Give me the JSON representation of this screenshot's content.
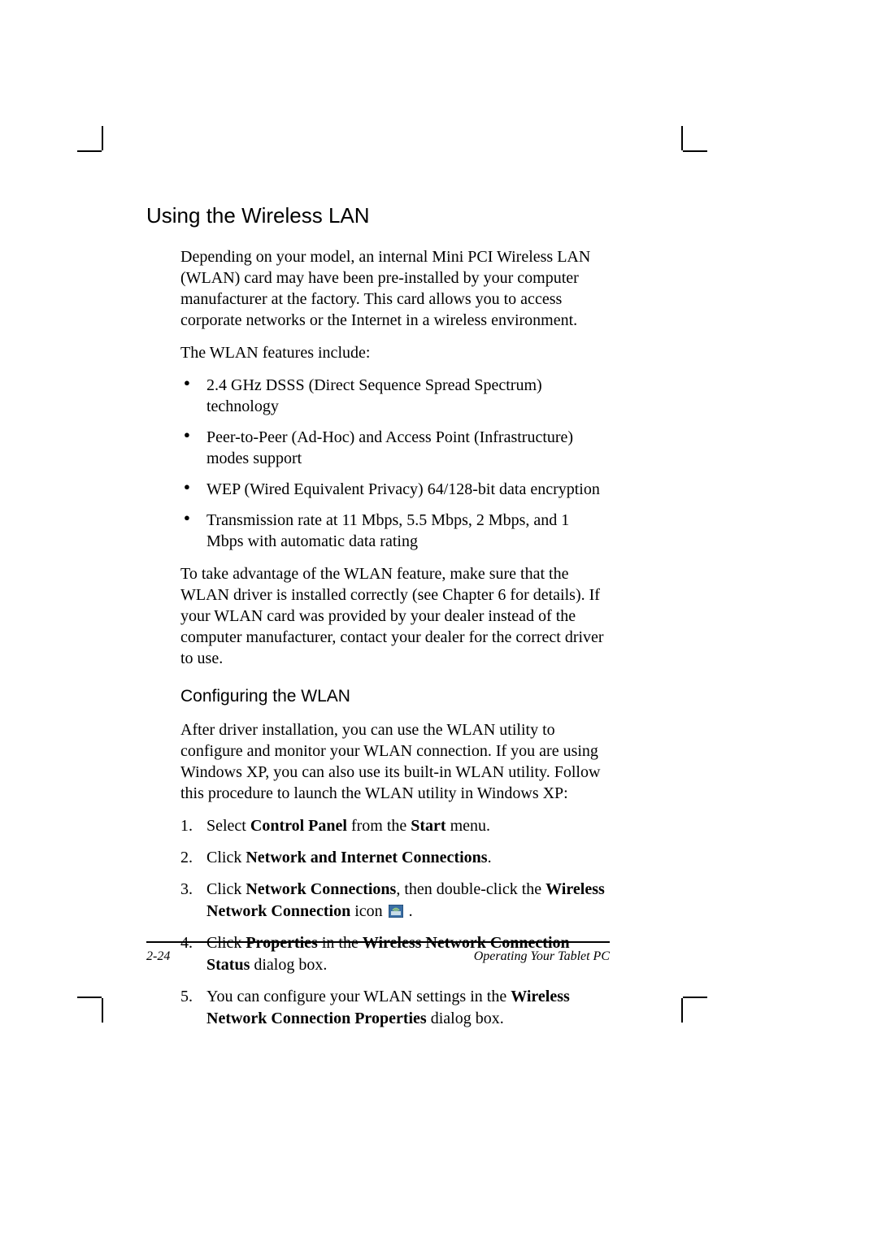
{
  "heading": "Using the Wireless LAN",
  "intro": "Depending on your model, an internal Mini PCI Wireless LAN (WLAN) card may have been pre-installed by your computer manufacturer at the factory. This card allows you to access corporate networks or the Internet in a wireless environment.",
  "features_lead": "The WLAN features include:",
  "bullets": [
    "2.4 GHz DSSS (Direct Sequence Spread Spectrum) technology",
    "Peer-to-Peer (Ad-Hoc) and Access Point (Infrastructure) modes support",
    "WEP (Wired Equivalent Privacy) 64/128-bit data encryption",
    "Transmission rate at 11 Mbps, 5.5 Mbps, 2 Mbps, and 1 Mbps with automatic data rating"
  ],
  "advantage": "To take advantage of the WLAN feature, make sure that the WLAN driver is installed correctly (see Chapter 6 for details). If your WLAN card was provided by your dealer instead of the computer manufacturer, contact your dealer for the correct driver to use.",
  "subheading": "Configuring the WLAN",
  "config_intro": "After driver installation, you can use the WLAN utility to configure and monitor your WLAN connection. If you are using Windows XP, you can also use its built-in WLAN utility. Follow this procedure to launch the WLAN utility in Windows XP:",
  "steps": {
    "s1": {
      "pre": "Select ",
      "b1": "Control Panel",
      "mid": " from the ",
      "b2": "Start",
      "post": " menu."
    },
    "s2": {
      "pre": "Click ",
      "b1": "Network and Internet Connections",
      "post": "."
    },
    "s3": {
      "pre": "Click ",
      "b1": "Network Connections",
      "mid": ", then double-click the ",
      "b2": "Wireless Network Connection",
      "post1": " icon ",
      "post2": " ."
    },
    "s4": {
      "pre": "Click ",
      "b1": "Properties",
      "mid": " in the ",
      "b2": "Wireless Network Connection Status",
      "post": " dialog box."
    },
    "s5": {
      "pre": "You can configure your WLAN settings in the ",
      "b1": "Wireless Network Connection Properties",
      "post": " dialog box."
    }
  },
  "footer": {
    "page_num": "2-24",
    "title": "Operating Your Tablet PC"
  }
}
